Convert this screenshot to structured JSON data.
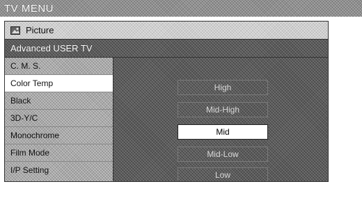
{
  "window": {
    "title": "TV MENU"
  },
  "menu": {
    "category_label": "Picture",
    "section_label": "Advanced USER TV"
  },
  "sidebar": {
    "items": [
      {
        "label": "C. M. S."
      },
      {
        "label": "Color Temp"
      },
      {
        "label": "Black"
      },
      {
        "label": "3D-Y/C"
      },
      {
        "label": "Monochrome"
      },
      {
        "label": "Film Mode"
      },
      {
        "label": "I/P Setting"
      }
    ],
    "selected_index": 1
  },
  "options": {
    "items": [
      {
        "label": "High"
      },
      {
        "label": "Mid-High"
      },
      {
        "label": "Mid"
      },
      {
        "label": "Mid-Low"
      },
      {
        "label": "Low"
      }
    ],
    "selected_index": 2
  },
  "icons": {
    "picture": "picture-icon"
  }
}
